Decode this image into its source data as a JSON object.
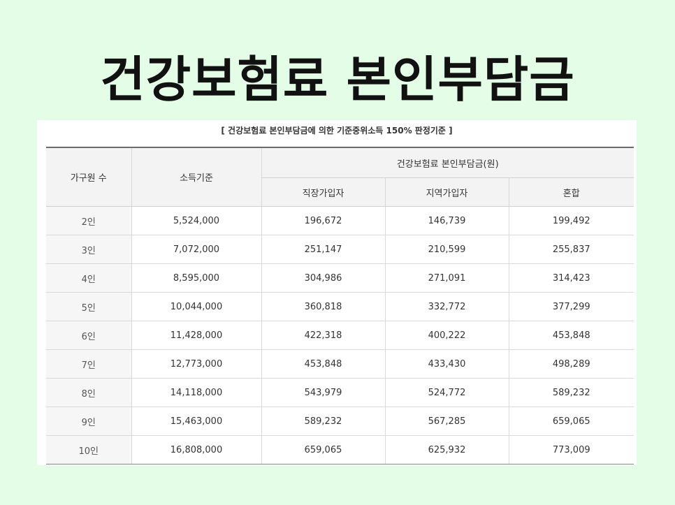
{
  "title": "건강보험료 본인부담금",
  "caption": "[ 건강보험료 본인부담금에 의한 기준중위소득 150% 판정기준 ]",
  "headers": {
    "members": "가구원 수",
    "income": "소득기준",
    "group": "건강보험료 본인부담금(원)",
    "employee": "직장가입자",
    "regional": "지역가입자",
    "mixed": "혼합"
  },
  "rows": [
    [
      "2인",
      "5,524,000",
      "196,672",
      "146,739",
      "199,492"
    ],
    [
      "3인",
      "7,072,000",
      "251,147",
      "210,599",
      "255,837"
    ],
    [
      "4인",
      "8,595,000",
      "304,986",
      "271,091",
      "314,423"
    ],
    [
      "5인",
      "10,044,000",
      "360,818",
      "332,772",
      "377,299"
    ],
    [
      "6인",
      "11,428,000",
      "422,318",
      "400,222",
      "453,848"
    ],
    [
      "7인",
      "12,773,000",
      "453,848",
      "433,430",
      "498,289"
    ],
    [
      "8인",
      "14,118,000",
      "543,979",
      "524,772",
      "589,232"
    ],
    [
      "9인",
      "15,463,000",
      "589,232",
      "567,285",
      "659,065"
    ],
    [
      "10인",
      "16,808,000",
      "659,065",
      "625,932",
      "773,009"
    ]
  ]
}
